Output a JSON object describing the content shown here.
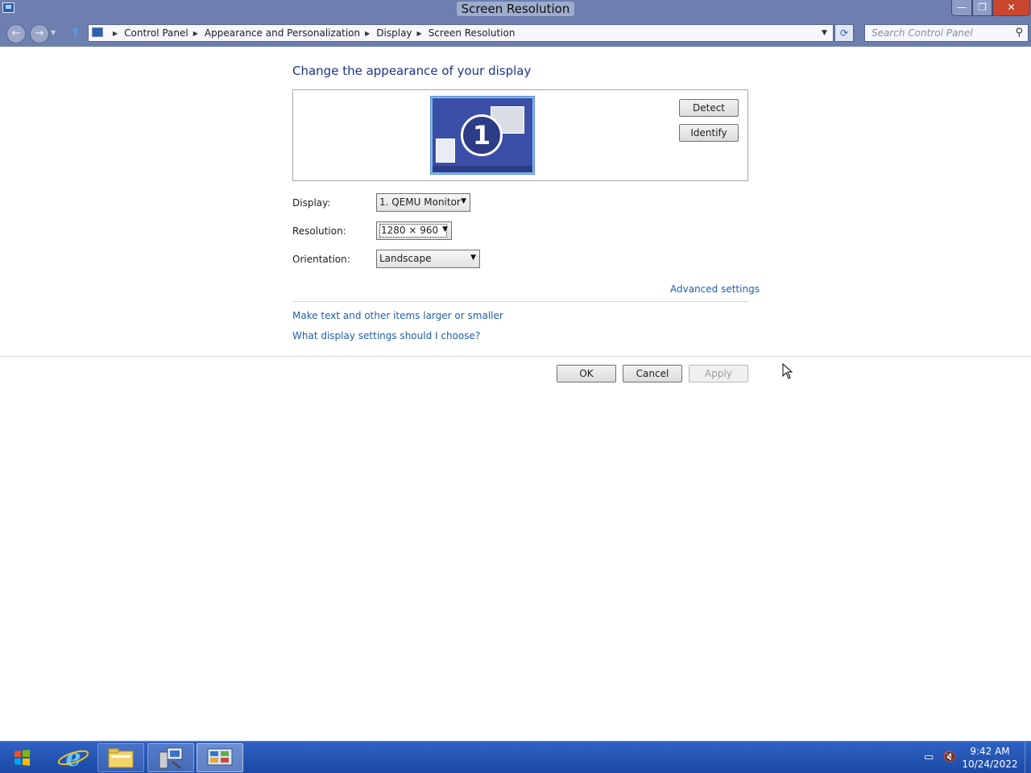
{
  "window": {
    "title": "Screen Resolution",
    "minimize_glyph": "—",
    "maximize_glyph": "❐",
    "close_glyph": "✕"
  },
  "navigation": {
    "back_glyph": "←",
    "forward_glyph": "→",
    "up_glyph": "↑",
    "breadcrumbs": [
      "Control Panel",
      "Appearance and Personalization",
      "Display",
      "Screen Resolution"
    ],
    "refresh_glyph": "⟳",
    "search_placeholder": "Search Control Panel"
  },
  "main": {
    "heading": "Change the appearance of your display",
    "monitor_number": "1",
    "detect_label": "Detect",
    "identify_label": "Identify",
    "display_label": "Display:",
    "display_value": "1. QEMU Monitor",
    "resolution_label": "Resolution:",
    "resolution_value": "1280 × 960",
    "orientation_label": "Orientation:",
    "orientation_value": "Landscape",
    "advanced_link": "Advanced settings",
    "text_size_link": "Make text and other items larger or smaller",
    "help_link": "What display settings should I choose?",
    "ok_label": "OK",
    "cancel_label": "Cancel",
    "apply_label": "Apply"
  },
  "taskbar": {
    "time": "9:42 AM",
    "date": "10/24/2022",
    "apps": [
      "start",
      "internet-explorer",
      "file-explorer",
      "server-manager",
      "control-panel"
    ]
  },
  "colors": {
    "titlebar": "#6c7fae",
    "heading": "#1e3287",
    "link": "#1e5fae",
    "taskbar": "#2459bd",
    "close_button": "#c8462e"
  }
}
